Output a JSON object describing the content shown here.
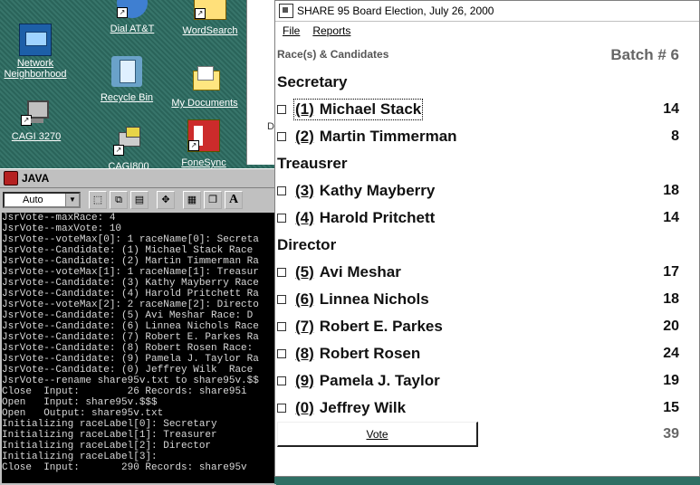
{
  "desktop": {
    "icons": [
      {
        "id": "dial-att",
        "label": "Dial AT&T"
      },
      {
        "id": "wordsearch",
        "label": "WordSearch"
      },
      {
        "id": "network",
        "label": "Network Neighborhood"
      },
      {
        "id": "recycle",
        "label": "Recycle Bin"
      },
      {
        "id": "mydocs",
        "label": "My Documents"
      },
      {
        "id": "cagi3270",
        "label": "CAGI 3270"
      },
      {
        "id": "cagi800",
        "label": "CAGI800"
      },
      {
        "id": "fonesync",
        "label": "FoneSync"
      }
    ],
    "behind_window_fragment": "Di"
  },
  "java_console": {
    "title": "JAVA",
    "font_combo": "Auto",
    "toolbar_letter": "A",
    "lines": [
      "JsrVote--maxRace: 4",
      "JsrVote--maxVote: 10",
      "JsrVote--voteMax[0]: 1 raceName[0]: Secreta",
      "JsrVote--Candidate: (1) Michael Stack Race",
      "JsrVote--Candidate: (2) Martin Timmerman Ra",
      "JsrVote--voteMax[1]: 1 raceName[1]: Treasur",
      "JsrVote--Candidate: (3) Kathy Mayberry Race",
      "JsrVote--Candidate: (4) Harold Pritchett Ra",
      "JsrVote--voteMax[2]: 2 raceName[2]: Directo",
      "JsrVote--Candidate: (5) Avi Meshar Race: D",
      "JsrVote--Candidate: (6) Linnea Nichols Race",
      "JsrVote--Candidate: (7) Robert E. Parkes Ra",
      "JsrVote--Candidate: (8) Robert Rosen Race:",
      "JsrVote--Candidate: (9) Pamela J. Taylor Ra",
      "JsrVote--Candidate: (0) Jeffrey Wilk  Race",
      "JsrVote--rename share95v.txt to share95v.$$",
      "Close  Input:        26 Records: share95i",
      "Open   Input: share95v.$$$",
      "Open   Output: share95v.txt",
      "Initializing raceLabel[0]: Secretary",
      "Initializing raceLabel[1]: Treasurer",
      "Initializing raceLabel[2]: Director",
      "Initializing raceLabel[3]:",
      "Close  Input:       290 Records: share95v"
    ]
  },
  "election": {
    "title": "SHARE 95 Board Election, July 26, 2000",
    "menu": [
      "File",
      "Reports"
    ],
    "subhead": "Race(s) & Candidates",
    "batch_label": "Batch # 6",
    "races": [
      {
        "name": "Secretary",
        "candidates": [
          {
            "num": "(1)",
            "name": "Michael Stack",
            "count": "14",
            "focused": true
          },
          {
            "num": "(2)",
            "name": "Martin Timmerman",
            "count": "8"
          }
        ]
      },
      {
        "name": "Treausrer",
        "candidates": [
          {
            "num": "(3)",
            "name": "Kathy Mayberry",
            "count": "18"
          },
          {
            "num": "(4)",
            "name": "Harold Pritchett",
            "count": "14"
          }
        ]
      },
      {
        "name": "Director",
        "candidates": [
          {
            "num": "(5)",
            "name": "Avi Meshar",
            "count": "17"
          },
          {
            "num": "(6)",
            "name": "Linnea Nichols",
            "count": "18"
          },
          {
            "num": "(7)",
            "name": "Robert E. Parkes",
            "count": "20"
          },
          {
            "num": "(8)",
            "name": "Robert Rosen",
            "count": "24"
          },
          {
            "num": "(9)",
            "name": "Pamela J. Taylor",
            "count": "19"
          },
          {
            "num": "(0)",
            "name": "Jeffrey Wilk",
            "count": "15"
          }
        ]
      }
    ],
    "vote_button": "Vote",
    "total": "39"
  }
}
